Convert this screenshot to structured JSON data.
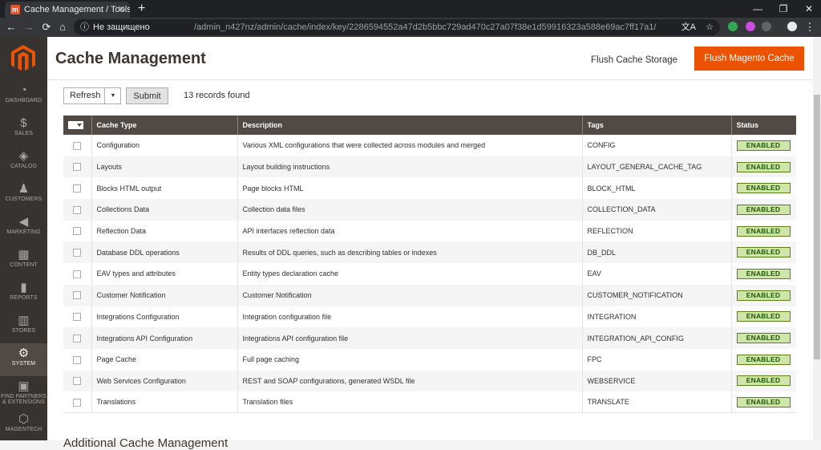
{
  "browser": {
    "tab_title": "Cache Management / Tools / Sys",
    "tab_favicon": "m",
    "new_tab": "+",
    "back_icon": "←",
    "forward_icon": "→",
    "reload_icon": "⟳",
    "home_icon": "⌂",
    "security_icon": "ⓘ",
    "security_label": "Не защищено",
    "url": "/admin_n427nz/admin/cache/index/key/2286594552a47d2b5bbc729ad470c27a07f38e1d59916323a588e69ac7ff17a1/",
    "translate_icon": "文A",
    "bookmark_icon": "☆",
    "menu_icon": "⋮",
    "minimize": "—",
    "maximize": "❐",
    "close": "✕"
  },
  "sidebar": {
    "items": [
      {
        "label": "DASHBOARD",
        "icon": "◔"
      },
      {
        "label": "SALES",
        "icon": "$"
      },
      {
        "label": "CATALOG",
        "icon": "◈"
      },
      {
        "label": "CUSTOMERS",
        "icon": "♟"
      },
      {
        "label": "MARKETING",
        "icon": "◀"
      },
      {
        "label": "CONTENT",
        "icon": "▦"
      },
      {
        "label": "REPORTS",
        "icon": "▮"
      },
      {
        "label": "STORES",
        "icon": "▥"
      },
      {
        "label": "SYSTEM",
        "icon": "⚙"
      },
      {
        "label": "FIND PARTNERS & EXTENSIONS",
        "icon": "▣"
      },
      {
        "label": "MAGENTECH",
        "icon": "⬡"
      }
    ]
  },
  "header": {
    "title": "Cache Management",
    "flush_storage": "Flush Cache Storage",
    "flush_magento": "Flush Magento Cache"
  },
  "toolbar": {
    "action": "Refresh",
    "arrow": "▼",
    "submit": "Submit",
    "records": "13 records found"
  },
  "grid": {
    "columns": [
      "Cache Type",
      "Description",
      "Tags",
      "Status"
    ],
    "rows": [
      {
        "type": "Configuration",
        "description": "Various XML configurations that were collected across modules and merged",
        "tags": "CONFIG",
        "status": "ENABLED"
      },
      {
        "type": "Layouts",
        "description": "Layout building instructions",
        "tags": "LAYOUT_GENERAL_CACHE_TAG",
        "status": "ENABLED"
      },
      {
        "type": "Blocks HTML output",
        "description": "Page blocks HTML",
        "tags": "BLOCK_HTML",
        "status": "ENABLED"
      },
      {
        "type": "Collections Data",
        "description": "Collection data files",
        "tags": "COLLECTION_DATA",
        "status": "ENABLED"
      },
      {
        "type": "Reflection Data",
        "description": "API interfaces reflection data",
        "tags": "REFLECTION",
        "status": "ENABLED"
      },
      {
        "type": "Database DDL operations",
        "description": "Results of DDL queries, such as describing tables or indexes",
        "tags": "DB_DDL",
        "status": "ENABLED"
      },
      {
        "type": "EAV types and attributes",
        "description": "Entity types declaration cache",
        "tags": "EAV",
        "status": "ENABLED"
      },
      {
        "type": "Customer Notification",
        "description": "Customer Notification",
        "tags": "CUSTOMER_NOTIFICATION",
        "status": "ENABLED"
      },
      {
        "type": "Integrations Configuration",
        "description": "Integration configuration file",
        "tags": "INTEGRATION",
        "status": "ENABLED"
      },
      {
        "type": "Integrations API Configuration",
        "description": "Integrations API configuration file",
        "tags": "INTEGRATION_API_CONFIG",
        "status": "ENABLED"
      },
      {
        "type": "Page Cache",
        "description": "Full page caching",
        "tags": "FPC",
        "status": "ENABLED"
      },
      {
        "type": "Web Services Configuration",
        "description": "REST and SOAP configurations, generated WSDL file",
        "tags": "WEBSERVICE",
        "status": "ENABLED"
      },
      {
        "type": "Translations",
        "description": "Translation files",
        "tags": "TRANSLATE",
        "status": "ENABLED"
      }
    ]
  },
  "additional_title": "Additional Cache Management",
  "colors": {
    "accent": "#eb5202",
    "sidebar": "#373330",
    "grid_header": "#514943",
    "enabled_bg": "#d0e5a9"
  }
}
